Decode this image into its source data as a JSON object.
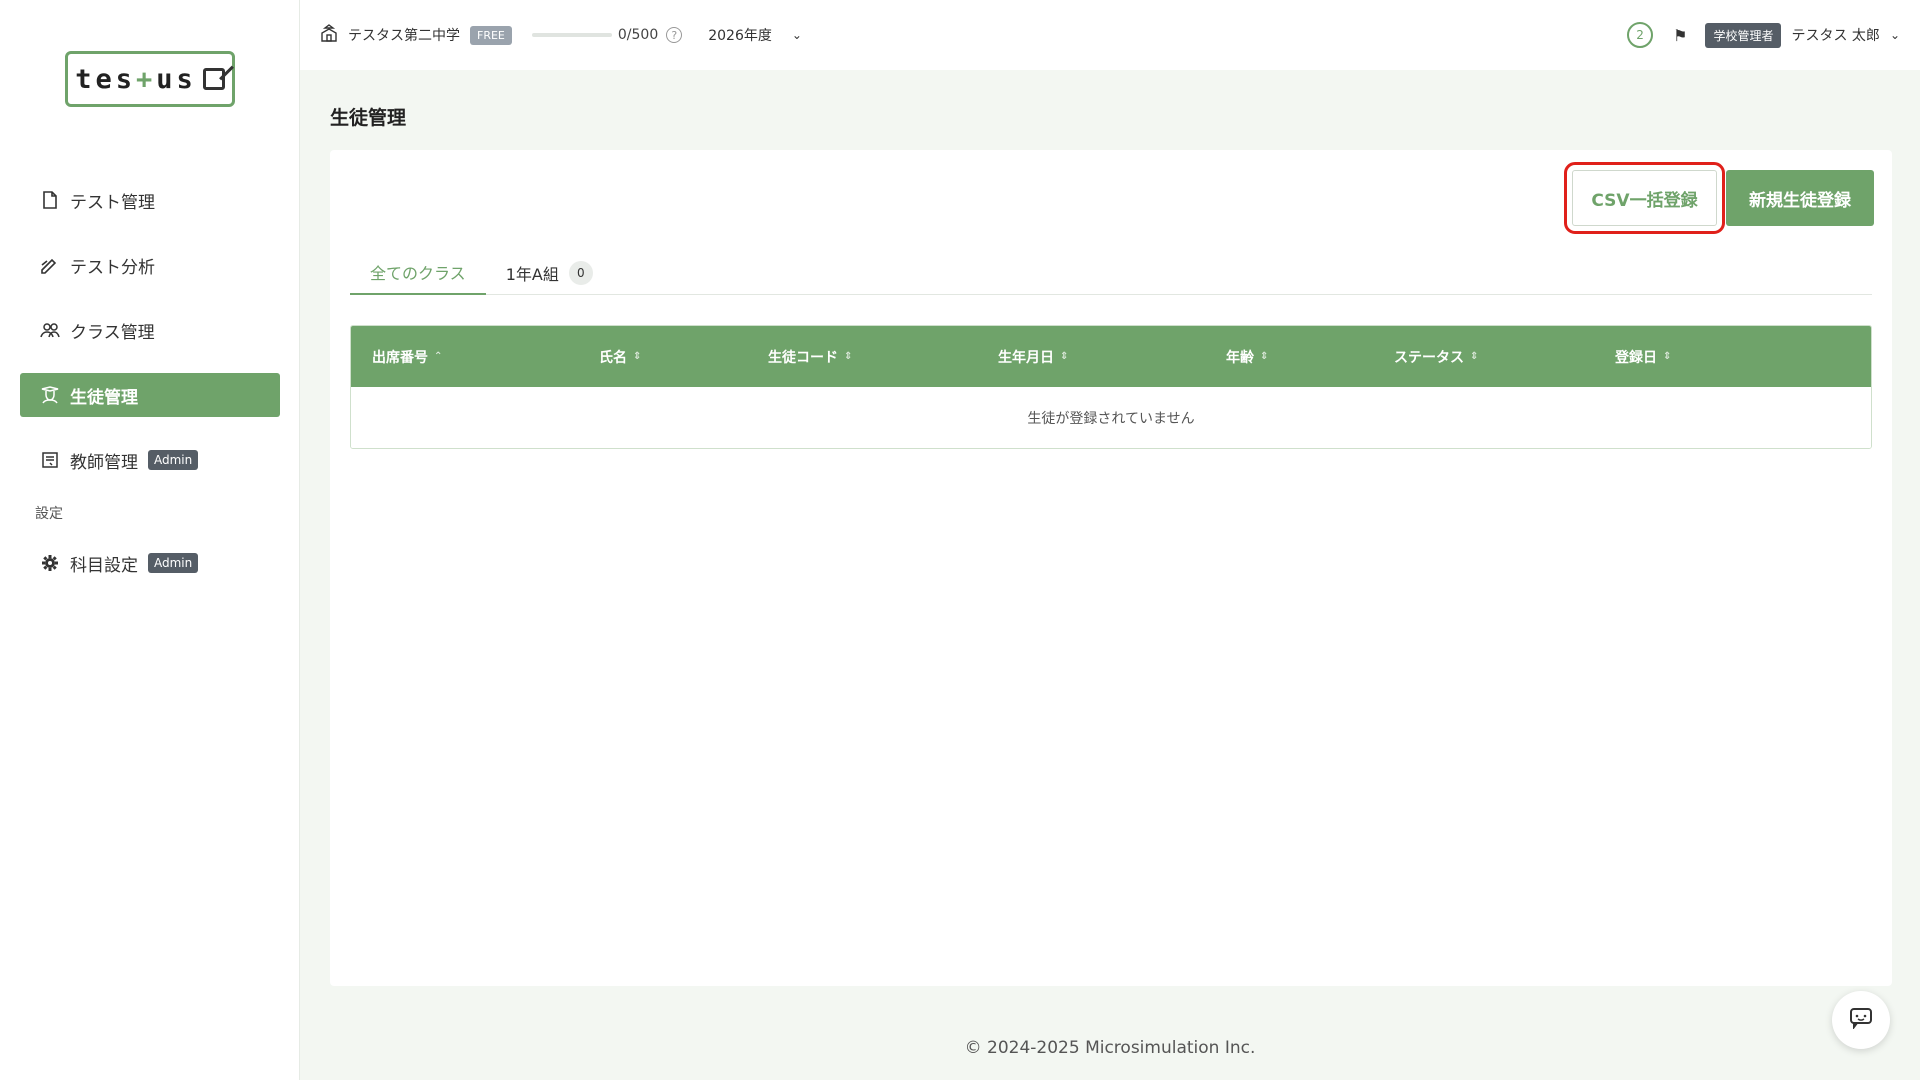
{
  "sidebar": {
    "logo_text": "tes+us",
    "items": [
      {
        "label": "テスト管理",
        "icon": "document-icon",
        "active": false
      },
      {
        "label": "テスト分析",
        "icon": "pen-chart-icon",
        "active": false
      },
      {
        "label": "クラス管理",
        "icon": "group-icon",
        "active": false
      },
      {
        "label": "生徒管理",
        "icon": "student-icon",
        "active": true
      },
      {
        "label": "教師管理",
        "icon": "teacher-icon",
        "active": false,
        "badge": "Admin"
      }
    ],
    "section_label": "設定",
    "settings_items": [
      {
        "label": "科目設定",
        "icon": "gear-icon",
        "badge": "Admin"
      }
    ]
  },
  "topbar": {
    "school_name": "テスタス第二中学",
    "plan_badge": "FREE",
    "usage": "0/500",
    "usage_fraction": 0,
    "help": "?",
    "year": "2026年度",
    "notification_count": "2",
    "role_badge": "学校管理者",
    "user_name": "テスタス 太郎"
  },
  "main": {
    "page_title": "生徒管理",
    "csv_button": "CSV一括登録",
    "new_button": "新規生徒登録",
    "tabs": [
      {
        "label": "全てのクラス",
        "active": true
      },
      {
        "label": "1年A組",
        "count": "0",
        "active": false
      }
    ],
    "table": {
      "columns": [
        "出席番号",
        "氏名",
        "生徒コード",
        "生年月日",
        "年齢",
        "ステータス",
        "登録日"
      ],
      "empty_message": "生徒が登録されていません"
    }
  },
  "footer": {
    "copyright": "© 2024-2025 Microsimulation Inc."
  },
  "colors": {
    "accent": "#6fa36a",
    "highlight_border": "#e0201a",
    "badge_dark": "#555d66"
  }
}
